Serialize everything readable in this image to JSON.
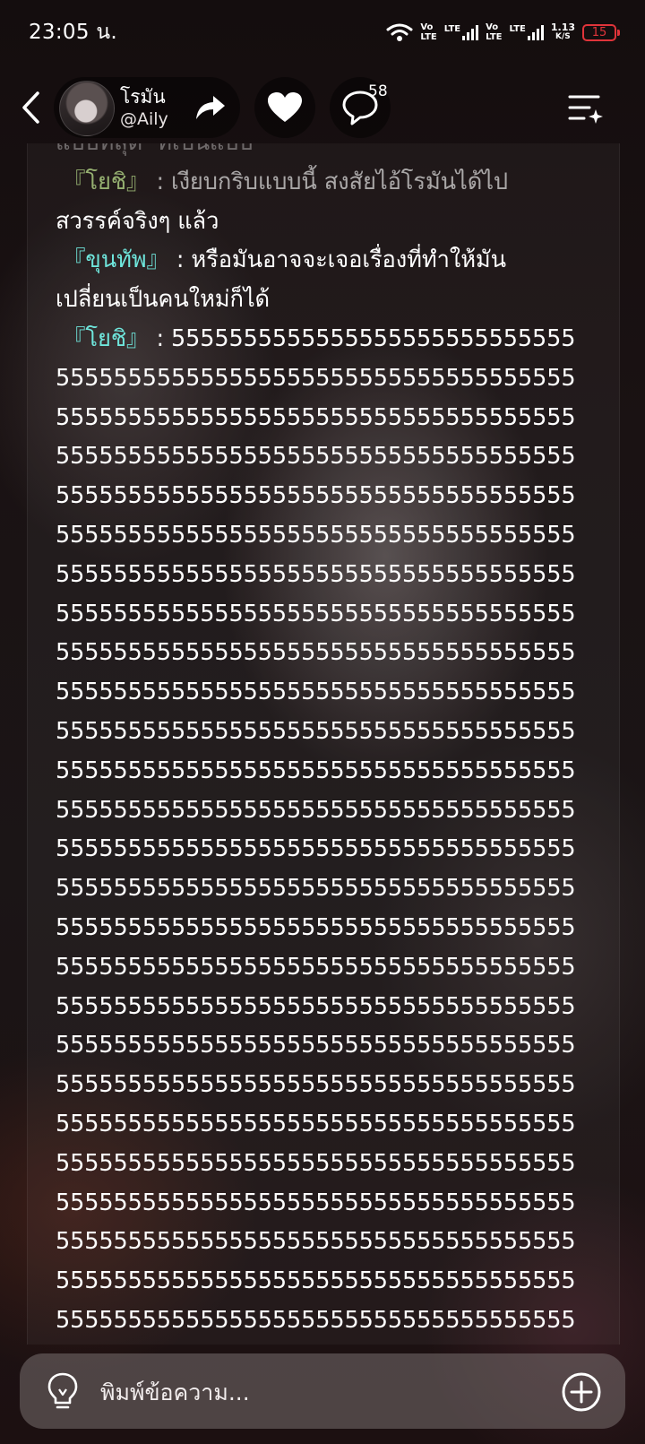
{
  "status_bar": {
    "time": "23:05 น.",
    "net1_top": "Vo",
    "net1_bottom": "LTE",
    "lte1": "LTE",
    "net2_top": "Vo",
    "net2_bottom": "LTE",
    "lte2": "LTE",
    "speed_value": "1.13",
    "speed_unit": "K/S",
    "battery": "15"
  },
  "header": {
    "name": "โรมัน",
    "handle": "@Aily",
    "comment_count": "58"
  },
  "story": {
    "lines": [
      {
        "cls": "fade-line",
        "parts": [
          {
            "t": "แบบที่สุด  ที่เป็นแบบ",
            "c": ""
          }
        ]
      },
      {
        "cls": "dim",
        "parts": [
          {
            "t": " 『โยชิ』",
            "c": "bracket-dim"
          },
          {
            "t": " : เงียบกริบแบบนี้ สงสัยไอ้โรมันได้ไป",
            "c": ""
          }
        ]
      },
      {
        "cls": "",
        "parts": [
          {
            "t": "สวรรค์จริงๆ แล้ว",
            "c": ""
          }
        ]
      },
      {
        "cls": "",
        "parts": [
          {
            "t": " 『ขุนทัพ』",
            "c": "speaker-cyan"
          },
          {
            "t": " : หรือมันอาจจะเจอเรื่องที่ทำให้มัน",
            "c": ""
          }
        ]
      },
      {
        "cls": "",
        "parts": [
          {
            "t": "เปลี่ยนเป็นคนใหม่ก็ได้",
            "c": ""
          }
        ]
      },
      {
        "cls": "",
        "parts": [
          {
            "t": " 『โยชิ』",
            "c": "speaker-cyan"
          },
          {
            "t": " : 5555555555555555555555555555",
            "c": ""
          }
        ]
      },
      {
        "cls": "",
        "parts": [
          {
            "t": "555555555555555555555555555555555555",
            "c": ""
          }
        ]
      },
      {
        "cls": "",
        "parts": [
          {
            "t": "555555555555555555555555555555555555",
            "c": ""
          }
        ]
      },
      {
        "cls": "",
        "parts": [
          {
            "t": "555555555555555555555555555555555555",
            "c": ""
          }
        ]
      },
      {
        "cls": "",
        "parts": [
          {
            "t": "555555555555555555555555555555555555",
            "c": ""
          }
        ]
      },
      {
        "cls": "",
        "parts": [
          {
            "t": "555555555555555555555555555555555555",
            "c": ""
          }
        ]
      },
      {
        "cls": "",
        "parts": [
          {
            "t": "555555555555555555555555555555555555",
            "c": ""
          }
        ]
      },
      {
        "cls": "",
        "parts": [
          {
            "t": "555555555555555555555555555555555555",
            "c": ""
          }
        ]
      },
      {
        "cls": "",
        "parts": [
          {
            "t": "555555555555555555555555555555555555",
            "c": ""
          }
        ]
      },
      {
        "cls": "",
        "parts": [
          {
            "t": "555555555555555555555555555555555555",
            "c": ""
          }
        ]
      },
      {
        "cls": "",
        "parts": [
          {
            "t": "555555555555555555555555555555555555",
            "c": ""
          }
        ]
      },
      {
        "cls": "",
        "parts": [
          {
            "t": "555555555555555555555555555555555555",
            "c": ""
          }
        ]
      },
      {
        "cls": "",
        "parts": [
          {
            "t": "555555555555555555555555555555555555",
            "c": ""
          }
        ]
      },
      {
        "cls": "",
        "parts": [
          {
            "t": "555555555555555555555555555555555555",
            "c": ""
          }
        ]
      },
      {
        "cls": "",
        "parts": [
          {
            "t": "555555555555555555555555555555555555",
            "c": ""
          }
        ]
      },
      {
        "cls": "",
        "parts": [
          {
            "t": "555555555555555555555555555555555555",
            "c": ""
          }
        ]
      },
      {
        "cls": "",
        "parts": [
          {
            "t": "555555555555555555555555555555555555",
            "c": ""
          }
        ]
      },
      {
        "cls": "",
        "parts": [
          {
            "t": "555555555555555555555555555555555555",
            "c": ""
          }
        ]
      },
      {
        "cls": "",
        "parts": [
          {
            "t": "555555555555555555555555555555555555",
            "c": ""
          }
        ]
      },
      {
        "cls": "",
        "parts": [
          {
            "t": "555555555555555555555555555555555555",
            "c": ""
          }
        ]
      },
      {
        "cls": "",
        "parts": [
          {
            "t": "555555555555555555555555555555555555",
            "c": ""
          }
        ]
      },
      {
        "cls": "",
        "parts": [
          {
            "t": "555555555555555555555555555555555555",
            "c": ""
          }
        ]
      },
      {
        "cls": "",
        "parts": [
          {
            "t": "555555555555555555555555555555555555",
            "c": ""
          }
        ]
      },
      {
        "cls": "",
        "parts": [
          {
            "t": "555555555555555555555555555555555555",
            "c": ""
          }
        ]
      },
      {
        "cls": "",
        "parts": [
          {
            "t": "555555555555555555555555555555555555",
            "c": ""
          }
        ]
      },
      {
        "cls": "",
        "parts": [
          {
            "t": "555555555555555555555555555555555555",
            "c": ""
          }
        ]
      },
      {
        "cls": "",
        "parts": [
          {
            "t": "555555555555555555555555555555555555",
            "c": ""
          }
        ]
      }
    ]
  },
  "composer": {
    "placeholder": "พิมพ์ข้อความ..."
  },
  "icons": {
    "back": "chevron-left-icon",
    "share": "share-arrow-icon",
    "like": "heart-icon",
    "comment": "speech-bubble-icon",
    "menu": "menu-sparkle-icon",
    "bulb": "lightbulb-icon",
    "add": "plus-circle-icon"
  },
  "colors": {
    "speaker_cyan": "#6fe6dc",
    "speaker_green": "#b6f0a0",
    "battery_low": "#e0343a"
  }
}
